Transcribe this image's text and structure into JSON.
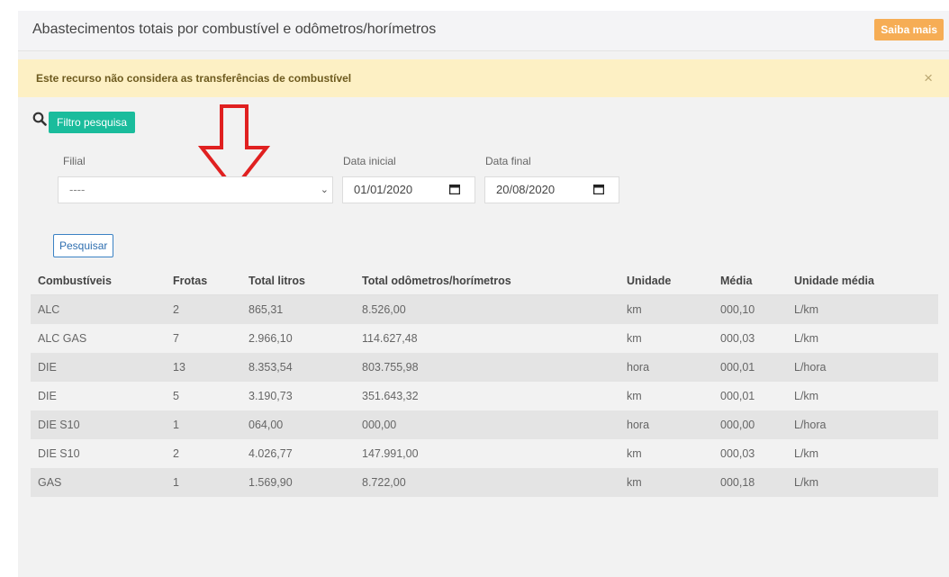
{
  "header": {
    "title": "Abastecimentos totais por combustível e odômetros/horímetros",
    "saiba_label": "Saiba mais"
  },
  "alert": {
    "text": "Este recurso não considera as transferências de combustível",
    "close": "×"
  },
  "filter": {
    "button_label": "Filtro pesquisa",
    "filial_label": "Filial",
    "filial_value": "----",
    "data_inicial_label": "Data inicial",
    "data_inicial_value": "01/01/2020",
    "data_final_label": "Data final",
    "data_final_value": "20/08/2020",
    "pesquisar_label": "Pesquisar"
  },
  "table": {
    "headers": [
      "Combustíveis",
      "Frotas",
      "Total litros",
      "Total odômetros/horímetros",
      "Unidade",
      "Média",
      "Unidade média"
    ],
    "rows": [
      [
        "ALC",
        "2",
        "865,31",
        "8.526,00",
        "km",
        "000,10",
        "L/km"
      ],
      [
        "ALC GAS",
        "7",
        "2.966,10",
        "114.627,48",
        "km",
        "000,03",
        "L/km"
      ],
      [
        "DIE",
        "13",
        "8.353,54",
        "803.755,98",
        "hora",
        "000,01",
        "L/hora"
      ],
      [
        "DIE",
        "5",
        "3.190,73",
        "351.643,32",
        "km",
        "000,01",
        "L/km"
      ],
      [
        "DIE S10",
        "1",
        "064,00",
        "000,00",
        "hora",
        "000,00",
        "L/hora"
      ],
      [
        "DIE S10",
        "2",
        "4.026,77",
        "147.991,00",
        "km",
        "000,03",
        "L/km"
      ],
      [
        "GAS",
        "1",
        "1.569,90",
        "8.722,00",
        "km",
        "000,18",
        "L/km"
      ]
    ]
  },
  "colors": {
    "accent_green": "#1abc9c",
    "saiba_orange": "#f6ad55",
    "alert_bg": "#fdf0c4",
    "arrow_red": "#e02020"
  },
  "icons": [
    "search-icon",
    "calendar-icon",
    "chevron-down-icon",
    "close-icon",
    "down-arrow-icon"
  ]
}
